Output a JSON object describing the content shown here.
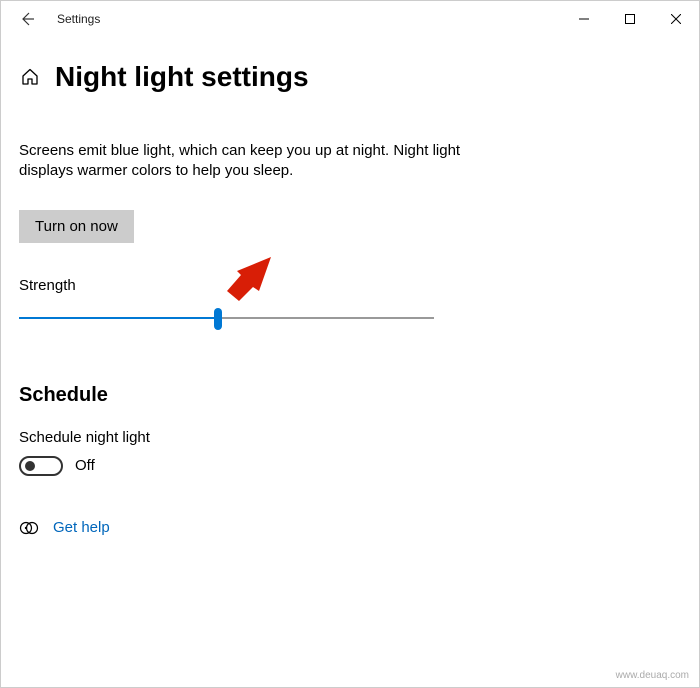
{
  "window": {
    "title": "Settings"
  },
  "page": {
    "heading": "Night light settings",
    "description": "Screens emit blue light, which can keep you up at night. Night light displays warmer colors to help you sleep.",
    "turn_on_label": "Turn on now",
    "strength": {
      "label": "Strength",
      "value_percent": 48
    },
    "schedule": {
      "heading": "Schedule",
      "toggle_label": "Schedule night light",
      "state_text": "Off"
    },
    "help_link": "Get help"
  },
  "watermark": "www.deuaq.com",
  "colors": {
    "accent": "#0078d4",
    "annotation": "#d81e06"
  }
}
